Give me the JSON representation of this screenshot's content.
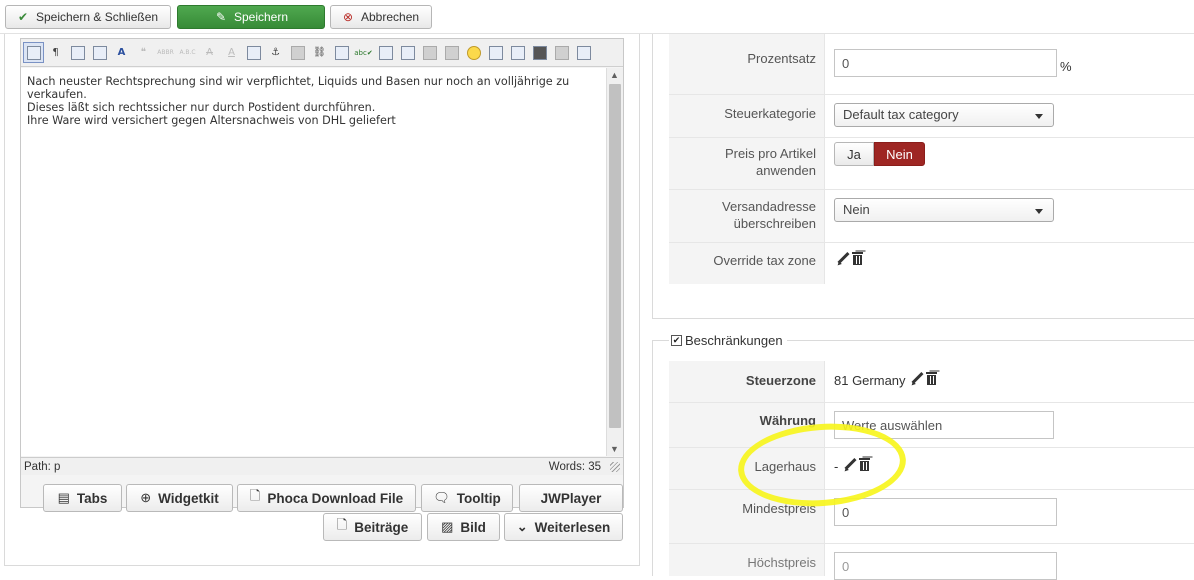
{
  "toolbar": {
    "save_close": "Speichern & Schließen",
    "save": "Speichern",
    "cancel": "Abbrechen"
  },
  "editor": {
    "content": [
      "Nach neuster Rechtsprechung sind wir verpflichtet, Liquids und Basen nur noch an volljährige zu verkaufen.",
      "Dieses läßt sich rechtssicher nur durch Postident durchführen.",
      "Ihre Ware wird versichert gegen Altersnachweis von DHL geliefert"
    ],
    "path": "Path:  p",
    "words": "Words: 35",
    "buttons": {
      "tabs": "Tabs",
      "widgetkit": "Widgetkit",
      "phoca": "Phoca Download File",
      "tooltip": "Tooltip",
      "jwplayer": "JWPlayer",
      "beitraege": "Beiträge",
      "bild": "Bild",
      "weiterlesen": "Weiterlesen"
    }
  },
  "tax": {
    "prozentsatz_label": "Prozentsatz",
    "prozentsatz_value": "0",
    "percent_sign": "%",
    "steuerkategorie_label": "Steuerkategorie",
    "steuerkategorie_value": "Default tax category",
    "preis_label": "Preis pro Artikel anwenden",
    "ja": "Ja",
    "nein": "Nein",
    "versand_label": "Versandadresse überschreiben",
    "versand_value": "Nein",
    "override_label": "Override tax zone"
  },
  "restrictions": {
    "legend": "Beschränkungen",
    "steuerzone_label": "Steuerzone",
    "steuerzone_value": "81 Germany",
    "waehrung_label": "Währung",
    "waehrung_placeholder": "Werte auswählen",
    "lagerhaus_label": "Lagerhaus",
    "lagerhaus_value": "-",
    "mindestpreis_label": "Mindestpreis",
    "mindestpreis_value": "0",
    "hoechstpreis_label": "Höchstpreis",
    "hoechstpreis_value": "0"
  },
  "colors": {
    "green_button": "#378b37",
    "active_toggle": "#9e2623",
    "highlight": "#f7f51a"
  }
}
